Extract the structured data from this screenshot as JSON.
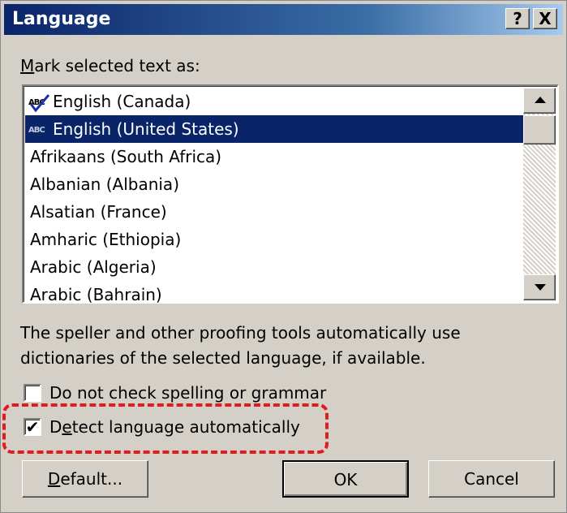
{
  "window": {
    "title": "Language",
    "help_button": "?",
    "close_button": "X"
  },
  "list_label": {
    "prefix": "M",
    "rest": "ark selected text as:"
  },
  "languages": [
    {
      "label": "English (Canada)",
      "spell_mark": true,
      "selected": false
    },
    {
      "label": "English (United States)",
      "spell_mark": true,
      "selected": true
    },
    {
      "label": "Afrikaans (South Africa)",
      "spell_mark": false,
      "selected": false
    },
    {
      "label": "Albanian (Albania)",
      "spell_mark": false,
      "selected": false
    },
    {
      "label": "Alsatian (France)",
      "spell_mark": false,
      "selected": false
    },
    {
      "label": "Amharic (Ethiopia)",
      "spell_mark": false,
      "selected": false
    },
    {
      "label": "Arabic (Algeria)",
      "spell_mark": false,
      "selected": false
    },
    {
      "label": "Arabic (Bahrain)",
      "spell_mark": false,
      "selected": false
    }
  ],
  "spell_mark_text": "ABC",
  "description_line1": "The speller and other proofing tools automatically use",
  "description_line2": "dictionaries of the selected language, if available.",
  "checkboxes": {
    "no_check": {
      "label": "Do not check spelling or grammar",
      "checked": false
    },
    "detect": {
      "prefix": "D",
      "underlined": "e",
      "rest": "tect language automatically",
      "checked": true,
      "mark": "✔"
    }
  },
  "buttons": {
    "default": {
      "underlined": "D",
      "rest": "efault..."
    },
    "ok": "OK",
    "cancel": "Cancel"
  },
  "colors": {
    "selection": "#0a246a",
    "highlight_border": "#e01c1c",
    "title_bar_start": "#0a246a"
  }
}
